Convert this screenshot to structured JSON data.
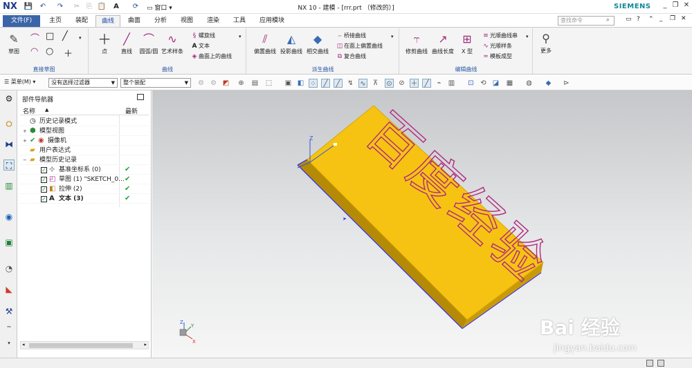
{
  "window": {
    "app_logo": "NX",
    "title": "NX 10 - 建模 - [rrr.prt （修改的）]",
    "brand": "SIEMENS",
    "window_menu": "窗口",
    "text_tool": "A"
  },
  "tabs": {
    "file": "文件(F)",
    "items": [
      "主页",
      "装配",
      "曲线",
      "曲面",
      "分析",
      "视图",
      "渲染",
      "工具",
      "应用模块"
    ],
    "active": "曲线"
  },
  "search": {
    "placeholder": "查找命令"
  },
  "ribbon": {
    "direct_sketch": {
      "label": "直接草图",
      "sketch": "草图"
    },
    "curve": {
      "label": "曲线",
      "point": "点",
      "line": "直线",
      "arc": "圆弧/圆",
      "studio_spline": "艺术样条",
      "helix": "螺旋线",
      "text": "文本",
      "curve_on_surface": "曲面上的曲线"
    },
    "derived": {
      "label": "派生曲线",
      "offset": "偏置曲线",
      "project": "投影曲线",
      "intersect": "相交曲线",
      "bridge": "桥接曲线",
      "offset_in_face": "在面上偏置曲线",
      "composite": "复合曲线"
    },
    "edit": {
      "label": "编辑曲线",
      "trim": "修剪曲线",
      "length": "曲线长度",
      "x_form": "X 型",
      "smooth_string": "光顺曲线串",
      "smooth_spline": "光顺样条",
      "template_forming": "模板成型"
    },
    "more": "更多"
  },
  "toolbar2": {
    "menu": "菜单(M)",
    "filter": "没有选择过滤器",
    "assembly": "整个装配"
  },
  "navigator": {
    "title": "部件导航器",
    "col_name": "名称",
    "col_latest": "最新",
    "rows": [
      {
        "label": "历史记录模式"
      },
      {
        "label": "模型视图"
      },
      {
        "label": "摄像机"
      },
      {
        "label": "用户表达式"
      },
      {
        "label": "模型历史记录"
      },
      {
        "label": "基准坐标系 (0)",
        "latest": "✔"
      },
      {
        "label": "草图 (1) \"SKETCH_0...",
        "latest": "✔"
      },
      {
        "label": "拉伸 (2)",
        "latest": "✔"
      },
      {
        "label": "文本 (3)",
        "latest": "✔"
      }
    ]
  },
  "viewport": {
    "engraved_text": "百度经验",
    "triad_labels": {
      "z": "Z",
      "y": "Y",
      "x": "X"
    }
  },
  "watermark": {
    "main": "Bai 经验",
    "sub": "jingyan.baidu.com"
  },
  "colors": {
    "accent": "#3a65a8",
    "block": "#f6c313",
    "engraving": "#b0297e",
    "check": "#1fa339"
  }
}
